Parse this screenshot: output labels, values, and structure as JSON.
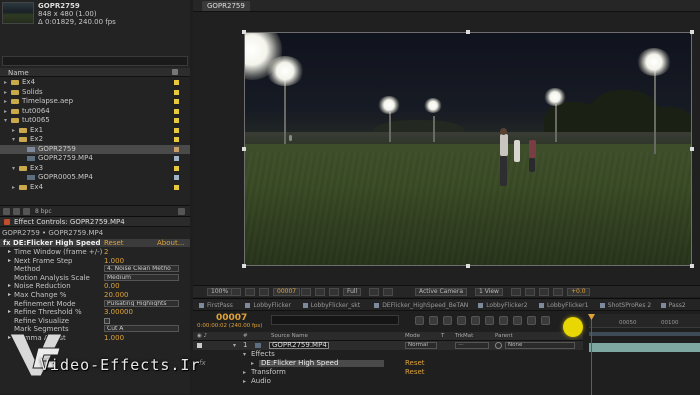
{
  "project": {
    "item_name": "GOPR2759",
    "item_dims": "848 x 480 (1.00)",
    "item_duration": "Δ 0:01829, 240.00 fps",
    "column_name": "Name",
    "tree": [
      {
        "label": "Ex4",
        "type": "folder",
        "indent": 0,
        "open": false,
        "swatch": "#e6c93c"
      },
      {
        "label": "Solids",
        "type": "folder",
        "indent": 0,
        "open": false,
        "swatch": "#e6c93c"
      },
      {
        "label": "Timelapse.aep",
        "type": "folder",
        "indent": 0,
        "open": false,
        "swatch": "#e6c93c"
      },
      {
        "label": "tut0064",
        "type": "folder",
        "indent": 0,
        "open": false,
        "swatch": "#e6c93c"
      },
      {
        "label": "tut0065",
        "type": "folder",
        "indent": 0,
        "open": true,
        "swatch": "#e6c93c"
      },
      {
        "label": "Ex1",
        "type": "folder",
        "indent": 1,
        "open": false,
        "swatch": "#e6c93c"
      },
      {
        "label": "Ex2",
        "type": "folder",
        "indent": 1,
        "open": true,
        "swatch": "#e6c93c"
      },
      {
        "label": "GOPR2759",
        "type": "comp",
        "indent": 2,
        "open": false,
        "swatch": "#c9a06a",
        "selected": true
      },
      {
        "label": "GOPR2759.MP4",
        "type": "footage",
        "indent": 2,
        "open": false,
        "swatch": "#9fb4c8"
      },
      {
        "label": "Ex3",
        "type": "folder",
        "indent": 1,
        "open": true,
        "swatch": "#e6c93c"
      },
      {
        "label": "GOPR0005.MP4",
        "type": "footage",
        "indent": 2,
        "open": false,
        "swatch": "#9fb4c8"
      },
      {
        "label": "Ex4",
        "type": "folder",
        "indent": 1,
        "open": false,
        "swatch": "#e6c93c"
      }
    ],
    "bpc": "8 bpc"
  },
  "effect_controls": {
    "tab_label": "Effect Controls: GOPR2759.MP4",
    "breadcrumb": "GOPR2759 • GOPR2759.MP4",
    "effect_name": "DE:Flicker High Speed",
    "reset_label": "Reset",
    "about_label": "About...",
    "params": [
      {
        "label": "Time Window (frame +/-)",
        "value": "2",
        "kind": "value",
        "indent": 1,
        "twirl": true
      },
      {
        "label": "Next Frame Step",
        "value": "1.000",
        "kind": "value",
        "indent": 1,
        "twirl": true
      },
      {
        "label": "Method",
        "value": "4. Noise Clean Metho",
        "kind": "select",
        "indent": 1
      },
      {
        "label": "Motion Analysis Scale",
        "value": "Medium",
        "kind": "select",
        "indent": 1
      },
      {
        "label": "Noise Reduction",
        "value": "0.00",
        "kind": "value",
        "indent": 1,
        "twirl": true
      },
      {
        "label": "Max Change %",
        "value": "20.000",
        "kind": "value",
        "indent": 1,
        "twirl": true
      },
      {
        "label": "Refinement Mode",
        "value": "Pulsating Highlights",
        "kind": "select",
        "indent": 1
      },
      {
        "label": "Refine Threshold %",
        "value": "3.00000",
        "kind": "value",
        "indent": 1,
        "twirl": true
      },
      {
        "label": "Refine Visualize",
        "value": "",
        "kind": "check",
        "indent": 1
      },
      {
        "label": "Mark Segments",
        "value": "Cut A",
        "kind": "select",
        "indent": 1
      },
      {
        "label": "Gamma Adjust",
        "value": "1.000",
        "kind": "value",
        "indent": 1,
        "twirl": true
      }
    ]
  },
  "viewer": {
    "tab_label": "GOPR2759",
    "zoom": "100%",
    "timecode": "00007",
    "resolution": "Full",
    "camera": "Active Camera",
    "views": "1 View",
    "offset": "+0.0"
  },
  "timeline": {
    "tabs": [
      "FirstPass",
      "LobbyFlicker",
      "LobbyFlicker_skt",
      "DEFlicker_HighSpeed_BeTAN",
      "LobbyFlicker2",
      "LobbyFlicker1",
      "ShotSProRes 2",
      "Pass2"
    ],
    "current_time": "00007",
    "time_sub": "0:00:00:02 (240.00 fps)",
    "columns": {
      "num": "#",
      "source": "Source Name",
      "mode": "Mode",
      "t": "T",
      "trkmat": "TrkMat",
      "parent": "Parent"
    },
    "layer": {
      "index": "1",
      "name": "GOPR2759.MP4",
      "mode": "Normal",
      "parent": "None"
    },
    "effects_label": "Effects",
    "effect_row": "DE:Flicker High Speed",
    "effect_reset": "Reset",
    "transform_label": "Transform",
    "transform_reset": "Reset",
    "audio_label": "Audio",
    "fx_badge": "fx",
    "ruler": [
      "00050",
      "00100"
    ]
  },
  "logo": {
    "text": "Video-Effects.Ir"
  }
}
